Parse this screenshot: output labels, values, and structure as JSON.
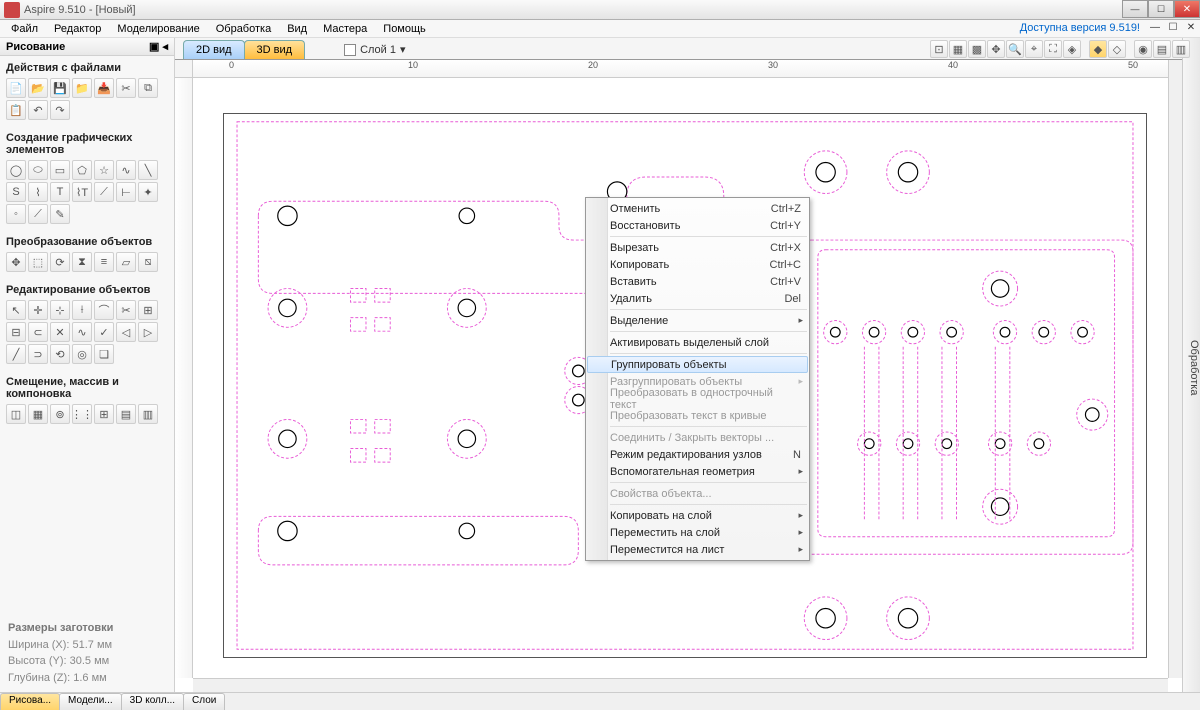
{
  "title": "Aspire 9.510 - [Новый]",
  "version_link": "Доступна версия 9.519!",
  "menus": [
    "Файл",
    "Редактор",
    "Моделирование",
    "Обработка",
    "Вид",
    "Мастера",
    "Помощь"
  ],
  "panel": {
    "header": "Рисование",
    "sections": {
      "files": "Действия с файлами",
      "create": "Создание графических элементов",
      "transform": "Преобразование объектов",
      "edit": "Редактирование объектов",
      "offset": "Смещение, массив и компоновка"
    }
  },
  "right_panel_label": "Обработка",
  "footer": {
    "title": "Размеры заготовки",
    "width": "Ширина  (X): 51.7 мм",
    "height": "Высота  (Y): 30.5 мм",
    "depth": "Глубина (Z): 1.6 мм"
  },
  "bottom_tabs": [
    "Рисова...",
    "Модели...",
    "3D колл...",
    "Слои"
  ],
  "view_tabs": [
    "2D вид",
    "3D вид"
  ],
  "layer_label": "Слой 1",
  "ruler_ticks": [
    "0",
    "10",
    "20",
    "30",
    "40",
    "50"
  ],
  "context_menu": [
    {
      "label": "Отменить",
      "shortcut": "Ctrl+Z"
    },
    {
      "label": "Восстановить",
      "shortcut": "Ctrl+Y"
    },
    {
      "sep": true
    },
    {
      "label": "Вырезать",
      "shortcut": "Ctrl+X"
    },
    {
      "label": "Копировать",
      "shortcut": "Ctrl+C"
    },
    {
      "label": "Вставить",
      "shortcut": "Ctrl+V"
    },
    {
      "label": "Удалить",
      "shortcut": "Del"
    },
    {
      "sep": true
    },
    {
      "label": "Выделение",
      "sub": true
    },
    {
      "sep": true
    },
    {
      "label": "Активировать выделеный слой"
    },
    {
      "sep": true
    },
    {
      "label": "Группировать объекты",
      "hover": true
    },
    {
      "label": "Разгруппировать объекты",
      "disabled": true,
      "sub": true
    },
    {
      "label": "Преобразовать в однострочный текст",
      "disabled": true
    },
    {
      "label": "Преобразовать текст в кривые",
      "disabled": true
    },
    {
      "sep": true
    },
    {
      "label": "Соединить / Закрыть векторы ...",
      "disabled": true
    },
    {
      "label": "Режим редактирования узлов",
      "shortcut": "N"
    },
    {
      "label": "Вспомогательная геометрия",
      "sub": true
    },
    {
      "sep": true
    },
    {
      "label": "Свойства объекта...",
      "disabled": true
    },
    {
      "sep": true
    },
    {
      "label": "Копировать на слой",
      "sub": true
    },
    {
      "label": "Переместить на слой",
      "sub": true
    },
    {
      "label": "Переместится на лист",
      "sub": true
    }
  ],
  "icons": {
    "files": [
      "new",
      "open",
      "save",
      "open-folder",
      "inc-open",
      "cut",
      "copy",
      "paste",
      "undo",
      "redo"
    ],
    "create": [
      "circle",
      "ellipse",
      "rect",
      "rounded-rect",
      "polygon",
      "star",
      "curve",
      "line",
      "arc",
      "spiral",
      "wave",
      "text",
      "text-arc",
      "ruler",
      "dim",
      "dim2",
      "copy-shape",
      "bezier",
      "freehand"
    ],
    "transform": [
      "move",
      "scale",
      "align",
      "distribute",
      "rotate",
      "skew",
      "mirror",
      "center"
    ],
    "edit": [
      "pointer",
      "node",
      "node-add",
      "add-pt",
      "bevel",
      "chamfer",
      "group",
      "ungroup",
      "join",
      "weld",
      "trim",
      "extend",
      "break",
      "close",
      "convert",
      "profile",
      "outline",
      "text-curve",
      "measure",
      "fit"
    ],
    "offset": [
      "offset",
      "array",
      "circ-array",
      "nest",
      "nest2",
      "grid-array",
      "plate"
    ]
  },
  "right_toolbar_icons": [
    "snap",
    "grid",
    "gridsnap",
    "center",
    "zoom-win",
    "zoom-sel",
    "zoom-fit",
    "zoom-all",
    "toggle-a",
    "toggle-b",
    "toggle-c",
    "layer-a",
    "layer-b"
  ]
}
